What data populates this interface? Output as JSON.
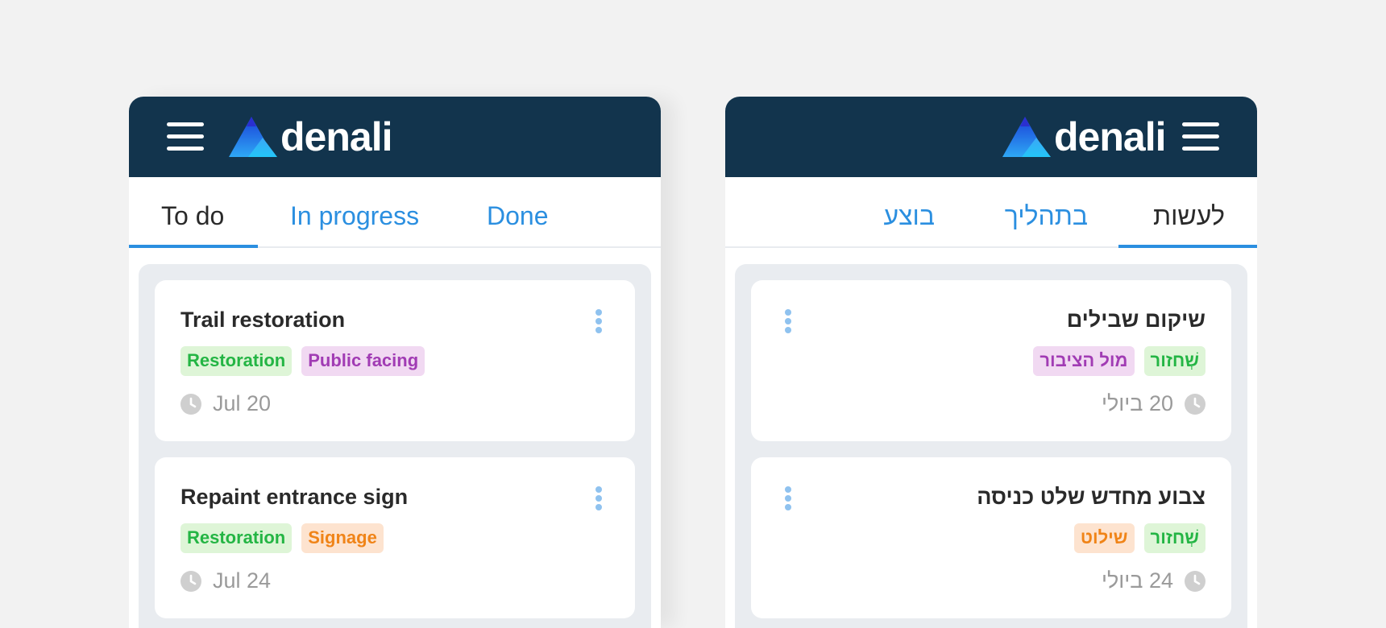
{
  "colors": {
    "header_bg": "#12344d",
    "accent": "#2b8fe0",
    "tag_green": "#24b544",
    "tag_purple": "#a13cb4",
    "tag_orange": "#f08418"
  },
  "ltr": {
    "brand": {
      "icon": "mountain-logo-icon",
      "name": "denali"
    },
    "tabs": [
      {
        "label": "To do",
        "active": true
      },
      {
        "label": "In progress",
        "active": false
      },
      {
        "label": "Done",
        "active": false
      }
    ],
    "cards": [
      {
        "title": "Trail restoration",
        "tags": [
          {
            "label": "Restoration",
            "color": "green"
          },
          {
            "label": "Public facing",
            "color": "purple"
          }
        ],
        "due": "Jul 20"
      },
      {
        "title": "Repaint entrance sign",
        "tags": [
          {
            "label": "Restoration",
            "color": "green"
          },
          {
            "label": "Signage",
            "color": "orange"
          }
        ],
        "due": "Jul 24"
      }
    ]
  },
  "rtl": {
    "brand": {
      "icon": "mountain-logo-icon",
      "name": "denali"
    },
    "tabs": [
      {
        "label": "לעשות",
        "active": true
      },
      {
        "label": "בתהליך",
        "active": false
      },
      {
        "label": "בוצע",
        "active": false
      }
    ],
    "cards": [
      {
        "title": "שיקום שבילים",
        "tags": [
          {
            "label": "שְׁחזור",
            "color": "green"
          },
          {
            "label": "מול הציבור",
            "color": "purple"
          }
        ],
        "due": "20 ביולי"
      },
      {
        "title": "צבוע מחדש שלט כניסה",
        "tags": [
          {
            "label": "שְׁחזור",
            "color": "green"
          },
          {
            "label": "שילוט",
            "color": "orange"
          }
        ],
        "due": "24 ביולי"
      }
    ]
  }
}
